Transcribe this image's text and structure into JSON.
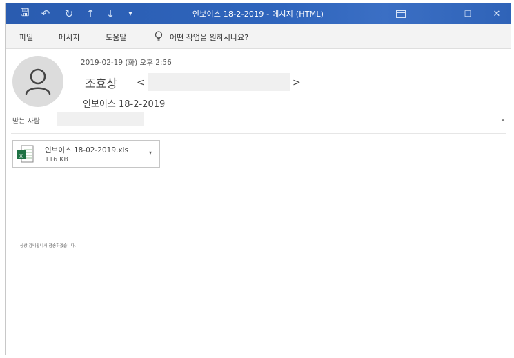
{
  "window": {
    "title": "인보이스 18-2-2019  -  메시지 (HTML)",
    "minimize": "–",
    "maximize": "☐",
    "close": "✕"
  },
  "quick_access": {
    "save_glyph": "🖫",
    "undo_glyph": "↶",
    "redo_glyph": "↻",
    "up_glyph": "↑",
    "down_glyph": "↓",
    "more_glyph": "▾"
  },
  "menu": {
    "items": [
      "파일",
      "메시지",
      "도움말"
    ],
    "tell_me": "어떤 작업을 원하시나요?"
  },
  "email": {
    "datetime": "2019-02-19 (화) 오후 2:56",
    "sender_name": "조효상",
    "sender_open": "<",
    "sender_close": ">",
    "subject": "인보이스 18-2-2019",
    "to_label": "받는 사람",
    "collapse_glyph": "⌃",
    "body": "상상 감비됩니서 첨송하겠습니다."
  },
  "attachment": {
    "name": "인보이스 18-02-2019.xls",
    "size": "116 KB",
    "caret": "▾"
  }
}
